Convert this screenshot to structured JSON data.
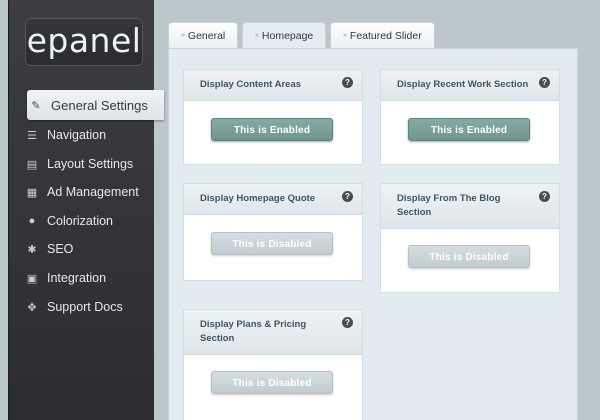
{
  "logo": {
    "text": "epanel"
  },
  "sidebar": {
    "items": [
      {
        "label": "General Settings",
        "icon": "wrench-icon",
        "glyph": "✎",
        "active": true
      },
      {
        "label": "Navigation",
        "icon": "list-icon",
        "glyph": "☰"
      },
      {
        "label": "Layout Settings",
        "icon": "layout-icon",
        "glyph": "▤"
      },
      {
        "label": "Ad Management",
        "icon": "grid-icon",
        "glyph": "▦"
      },
      {
        "label": "Colorization",
        "icon": "palette-icon",
        "glyph": "●"
      },
      {
        "label": "SEO",
        "icon": "magnifier-icon",
        "glyph": "✱"
      },
      {
        "label": "Integration",
        "icon": "integration-icon",
        "glyph": "▣"
      },
      {
        "label": "Support Docs",
        "icon": "support-icon",
        "glyph": "✥"
      }
    ]
  },
  "tabs": [
    {
      "label": "General"
    },
    {
      "label": "Homepage",
      "active": true
    },
    {
      "label": "Featured Slider"
    }
  ],
  "cards": [
    {
      "title": "Display Content Areas",
      "button": "This is Enabled",
      "state": "enabled"
    },
    {
      "title": "Display Recent Work Section",
      "button": "This is Enabled",
      "state": "enabled"
    },
    {
      "title": "Display Homepage Quote",
      "button": "This is Disabled",
      "state": "disabled"
    },
    {
      "title": "Display From The Blog Section",
      "button": "This is Disabled",
      "state": "disabled"
    },
    {
      "title": "Display Plans & Pricing Section",
      "button": "This is Disabled",
      "state": "disabled"
    }
  ],
  "help_glyph": "?",
  "tab_bullet": "»",
  "colors": {
    "enabled": "#7aa19a",
    "disabled": "#c9d3d6",
    "sidebar": "#343538"
  }
}
